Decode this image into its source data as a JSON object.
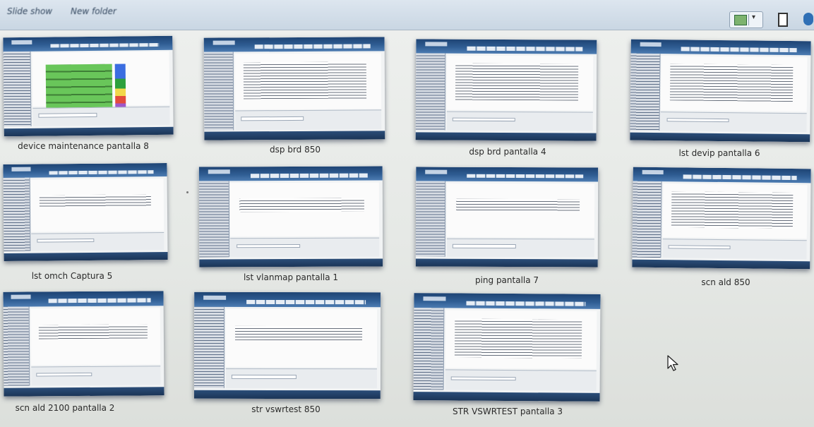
{
  "toolbar": {
    "slide_show_label": "Slide show",
    "new_folder_label": "New folder",
    "view_icon": "large-icons-view-icon",
    "pane_icon": "preview-pane-icon",
    "help_icon": "help-icon"
  },
  "files": [
    {
      "name": "device maintenance pantalla 8"
    },
    {
      "name": "dsp brd 850"
    },
    {
      "name": "dsp brd pantalla 4"
    },
    {
      "name": "lst devip pantalla 6"
    },
    {
      "name": "lst omch Captura 5"
    },
    {
      "name": "lst vlanmap pantalla 1"
    },
    {
      "name": "ping pantalla 7"
    },
    {
      "name": "scn ald 850"
    },
    {
      "name": "scn ald 2100 pantalla 2"
    },
    {
      "name": "str vswrtest 850"
    },
    {
      "name": "STR VSWRTEST pantalla 3"
    }
  ],
  "colors": {
    "window_header": "#2f5d93",
    "toolbar_bg": "#c9d6e3",
    "folder_bg": "#e6e9e6"
  }
}
